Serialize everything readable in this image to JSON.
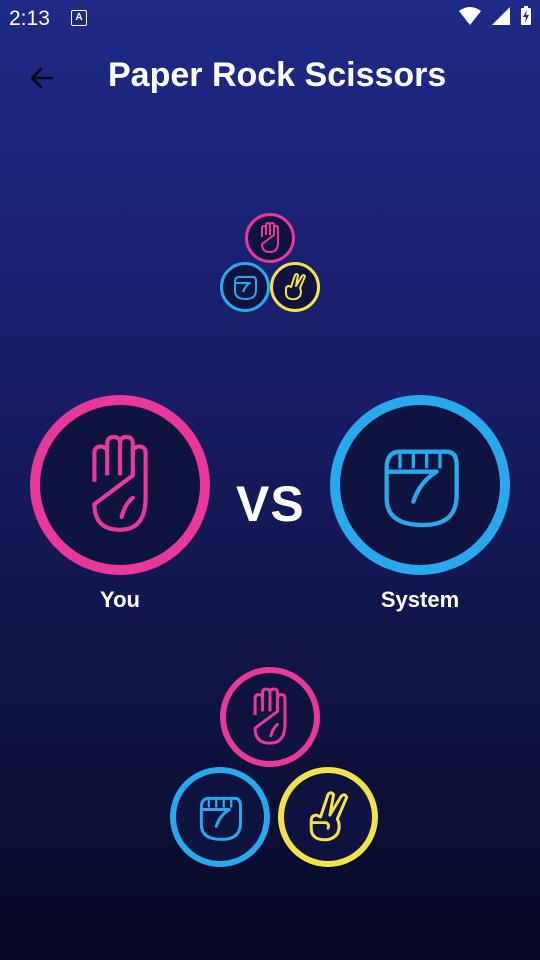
{
  "status_bar": {
    "time": "2:13",
    "notification_letter": "A"
  },
  "app_bar": {
    "title": "Paper Rock Scissors"
  },
  "match": {
    "vs_label": "VS",
    "player_label": "You",
    "opponent_label": "System",
    "player_choice": "paper",
    "opponent_choice": "rock"
  },
  "choices": [
    {
      "name": "paper",
      "color": "#e8399a"
    },
    {
      "name": "rock",
      "color": "#29a8ee"
    },
    {
      "name": "scissors",
      "color": "#f3e24a"
    }
  ],
  "colors": {
    "paper": "#e8399a",
    "rock": "#29a8ee",
    "scissors": "#f3e24a",
    "circle_fill": "#0e1340"
  }
}
